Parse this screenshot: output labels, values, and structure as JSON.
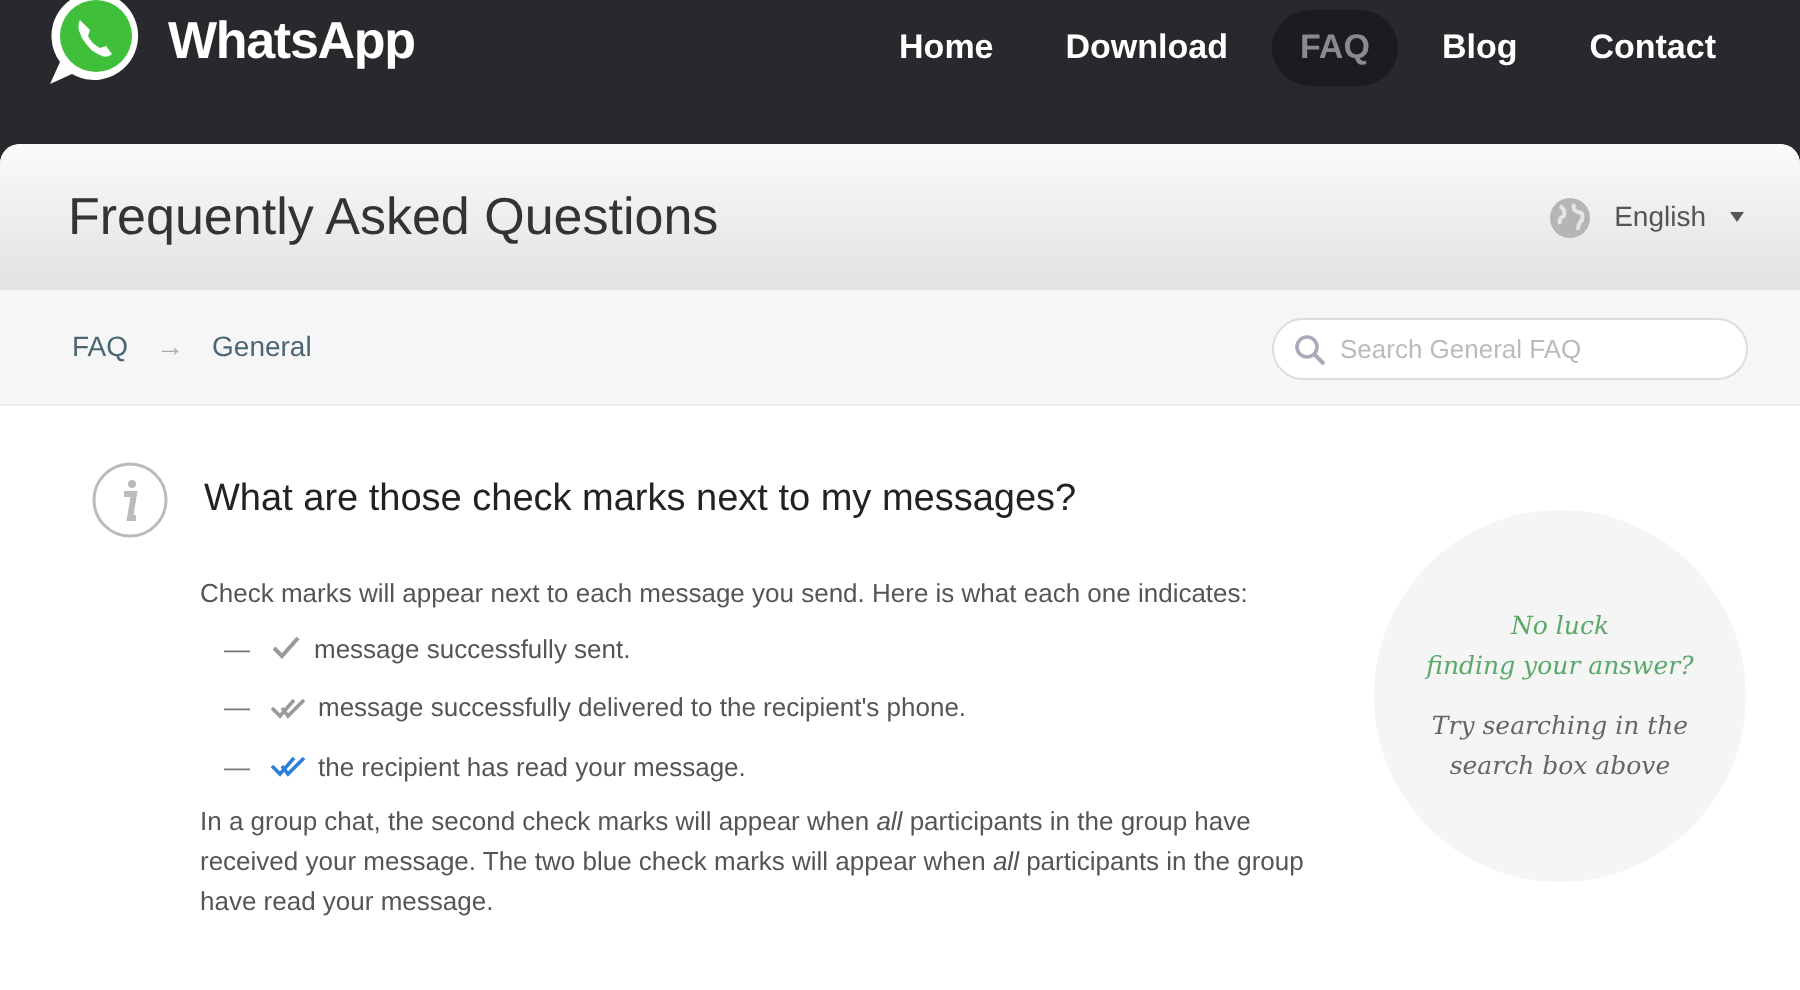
{
  "header": {
    "logo_text": "WhatsApp",
    "nav": [
      {
        "label": "Home",
        "selected": false
      },
      {
        "label": "Download",
        "selected": false
      },
      {
        "label": "FAQ",
        "selected": true
      },
      {
        "label": "Blog",
        "selected": false
      },
      {
        "label": "Contact",
        "selected": false
      }
    ]
  },
  "title_bar": {
    "title": "Frequently Asked Questions",
    "language": "English"
  },
  "breadcrumb": {
    "items": [
      "FAQ",
      "General"
    ],
    "separator": "→"
  },
  "search": {
    "placeholder": "Search General FAQ"
  },
  "article": {
    "question": "What are those check marks next to my messages?",
    "intro": "Check marks will appear next to each message you send. Here is what each one indicates:",
    "bullets": [
      {
        "kind": "sent",
        "dash": "—",
        "text": "message successfully sent."
      },
      {
        "kind": "delivered",
        "dash": "—",
        "text": "message successfully delivered to the recipient's phone."
      },
      {
        "kind": "read",
        "dash": "—",
        "text": "the recipient has read your message."
      }
    ],
    "paragraph": "In a group chat, the second check marks will appear when *all* participants in the group have received your message. The two blue check marks will appear when *all* participants in the group have read your message."
  },
  "help_bubble": {
    "heading": [
      "No luck",
      "finding your answer?"
    ],
    "hint": "Try searching in the search box above"
  }
}
